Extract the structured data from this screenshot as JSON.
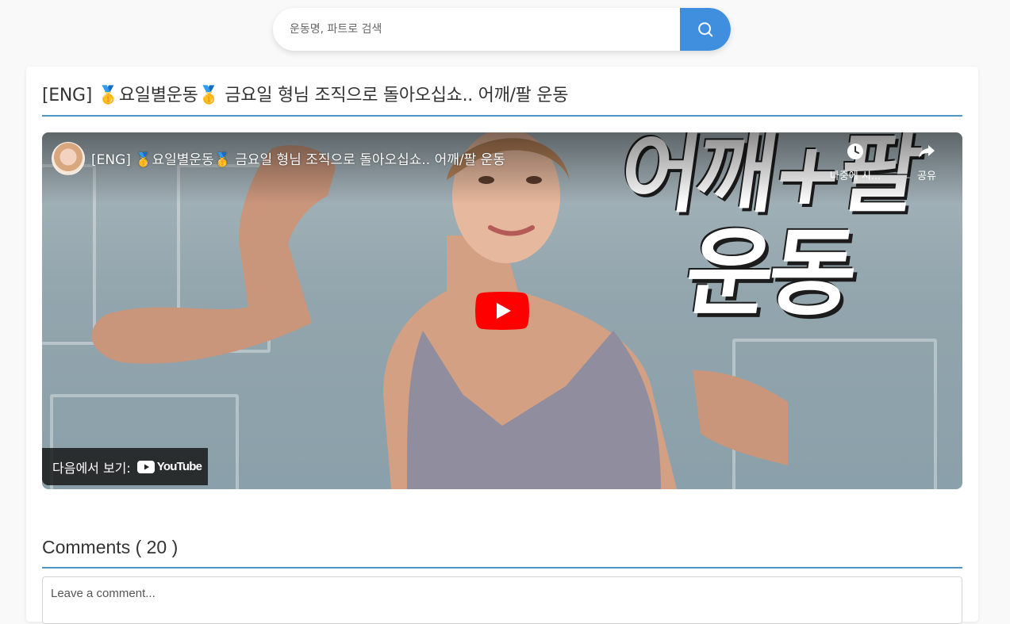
{
  "search": {
    "placeholder": "운동명, 파트로 검색",
    "button_icon": "search-icon",
    "accent": "#3f8fde"
  },
  "video": {
    "page_title": "[ENG] 🥇요일별운동🥇 금요일 형님 조직으로 돌아오십쇼.. 어깨/팔 운동",
    "player": {
      "title": "[ENG] 🥇요일별운동🥇 금요일 형님 조직으로 돌아오십쇼.. 어깨/팔 운동",
      "watch_later_label": "나중에 시...",
      "share_label": "공유",
      "watch_on_label": "다음에서 보기:",
      "youtube_label": "YouTube",
      "thumbnail_text_line1": "어깨+팔",
      "thumbnail_text_line2": "운동",
      "play_button_color": "#ff0000"
    }
  },
  "comments": {
    "heading": "Comments ( 20 )",
    "input_placeholder": "Leave a comment...",
    "rule_color": "#4b97c6"
  }
}
